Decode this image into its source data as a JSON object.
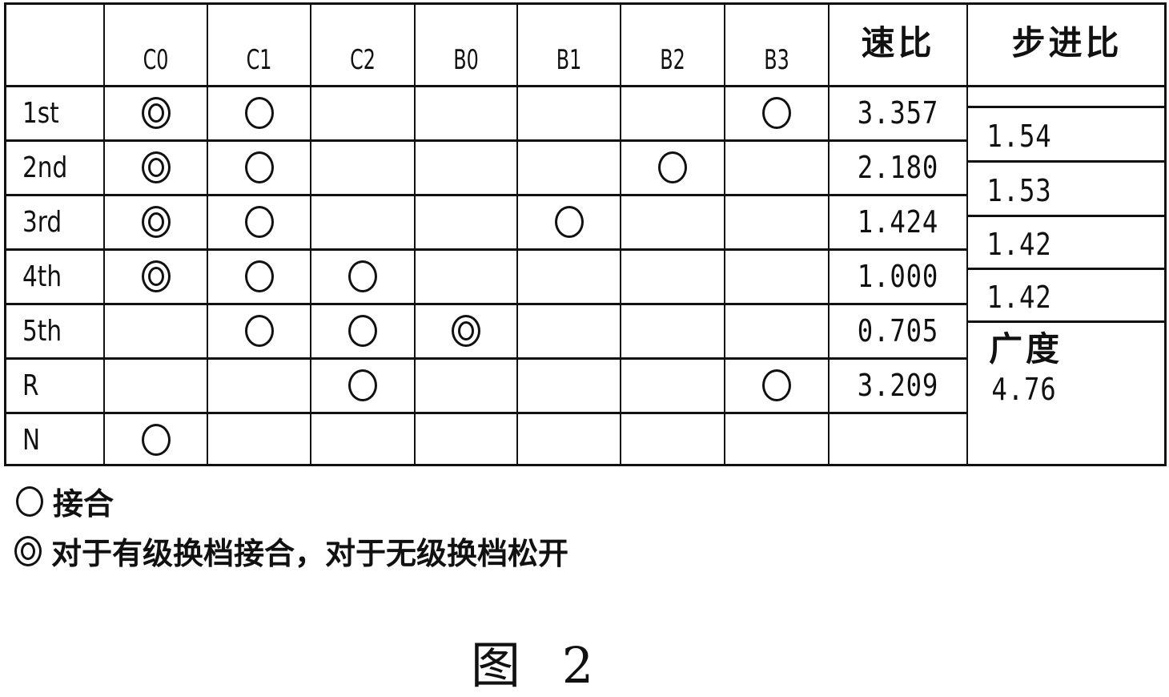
{
  "table": {
    "corner": "",
    "columns": [
      "C0",
      "C1",
      "C2",
      "B0",
      "B1",
      "B2",
      "B3"
    ],
    "speed_ratio_header": "速比",
    "step_ratio_header": "步进比",
    "rows": [
      {
        "gear": "1st",
        "cells": [
          "double",
          "single",
          "",
          "",
          "",
          "",
          "single"
        ],
        "speed_ratio": "3.357"
      },
      {
        "gear": "2nd",
        "cells": [
          "double",
          "single",
          "",
          "",
          "",
          "single",
          ""
        ],
        "speed_ratio": "2.180"
      },
      {
        "gear": "3rd",
        "cells": [
          "double",
          "single",
          "",
          "",
          "single",
          "",
          ""
        ],
        "speed_ratio": "1.424"
      },
      {
        "gear": "4th",
        "cells": [
          "double",
          "single",
          "single",
          "",
          "",
          "",
          ""
        ],
        "speed_ratio": "1.000"
      },
      {
        "gear": "5th",
        "cells": [
          "",
          "single",
          "single",
          "double",
          "",
          "",
          ""
        ],
        "speed_ratio": "0.705"
      },
      {
        "gear": "R",
        "cells": [
          "",
          "",
          "single",
          "",
          "",
          "",
          "single"
        ],
        "speed_ratio": "3.209"
      },
      {
        "gear": "N",
        "cells": [
          "single",
          "",
          "",
          "",
          "",
          "",
          ""
        ],
        "speed_ratio": ""
      }
    ],
    "step_ratios": [
      "1.54",
      "1.53",
      "1.42",
      "1.42"
    ],
    "spread_label": "广度",
    "spread_value": "4.76"
  },
  "legend": {
    "single_symbol": "single",
    "single_text": "接合",
    "double_symbol": "double",
    "double_text": "对于有级换档接合，对于无级换档松开"
  },
  "caption": "图 2"
}
